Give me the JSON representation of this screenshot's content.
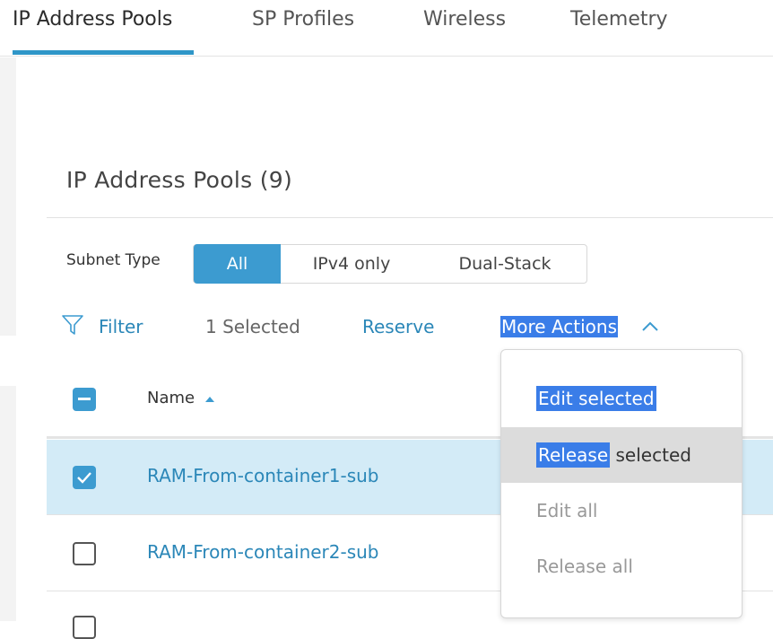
{
  "tabs": [
    {
      "label": "IP Address Pools",
      "active": true
    },
    {
      "label": "SP Profiles",
      "active": false
    },
    {
      "label": "Wireless",
      "active": false
    },
    {
      "label": "Telemetry",
      "active": false
    }
  ],
  "section": {
    "title": "IP Address Pools (9)"
  },
  "subnet_type": {
    "label": "Subnet Type",
    "options": [
      "All",
      "IPv4 only",
      "Dual-Stack"
    ],
    "selected": "All"
  },
  "toolbar": {
    "filter_label": "Filter",
    "selected_count": "1 Selected",
    "reserve_label": "Reserve",
    "more_actions_label": "More Actions"
  },
  "table": {
    "name_header": "Name",
    "rows": [
      {
        "name": "RAM-From-container1-sub",
        "checked": true
      },
      {
        "name": "RAM-From-container2-sub",
        "checked": false
      }
    ]
  },
  "menu": {
    "edit_selected_a": "Edit selected",
    "release_selected_a": "Release",
    "release_selected_b": " selected",
    "edit_all": "Edit all",
    "release_all": "Release all"
  },
  "colors": {
    "accent": "#3c9bd0",
    "link": "#2b87b8",
    "highlight": "#3a7de8",
    "selected_row": "#d3ebf7"
  }
}
